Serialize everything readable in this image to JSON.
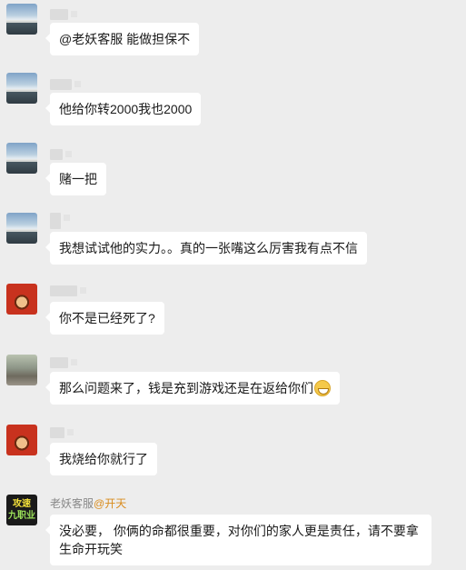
{
  "messages": [
    {
      "avatar": "landscape-avatar",
      "name": "",
      "text": "@老妖客服 能做担保不"
    },
    {
      "avatar": "landscape-avatar",
      "name": "",
      "text": "他给你转2000我也2000"
    },
    {
      "avatar": "landscape-avatar",
      "name": "",
      "text": "赌一把"
    },
    {
      "avatar": "landscape-avatar",
      "name": "",
      "text": "我想试试他的实力。。真的一张嘴这么厉害我有点不信"
    },
    {
      "avatar": "red-cartoon-avatar",
      "name": "",
      "text": "你不是已经死了?"
    },
    {
      "avatar": "street-photo-avatar",
      "name": "",
      "text": "那么问题来了，钱是充到游戏还是在返给你们",
      "emoji": "grinning-emoji"
    },
    {
      "avatar": "red-cartoon-avatar",
      "name": "",
      "text": "我烧给你就行了"
    },
    {
      "avatar": "game-logo-avatar",
      "name": "老妖客服",
      "mention": "@开天",
      "text": "没必要，  你俩的命都很重要，对你们的家人更是责任，请不要拿生命开玩笑",
      "avatar_text": [
        "攻速",
        "九职业"
      ]
    }
  ]
}
